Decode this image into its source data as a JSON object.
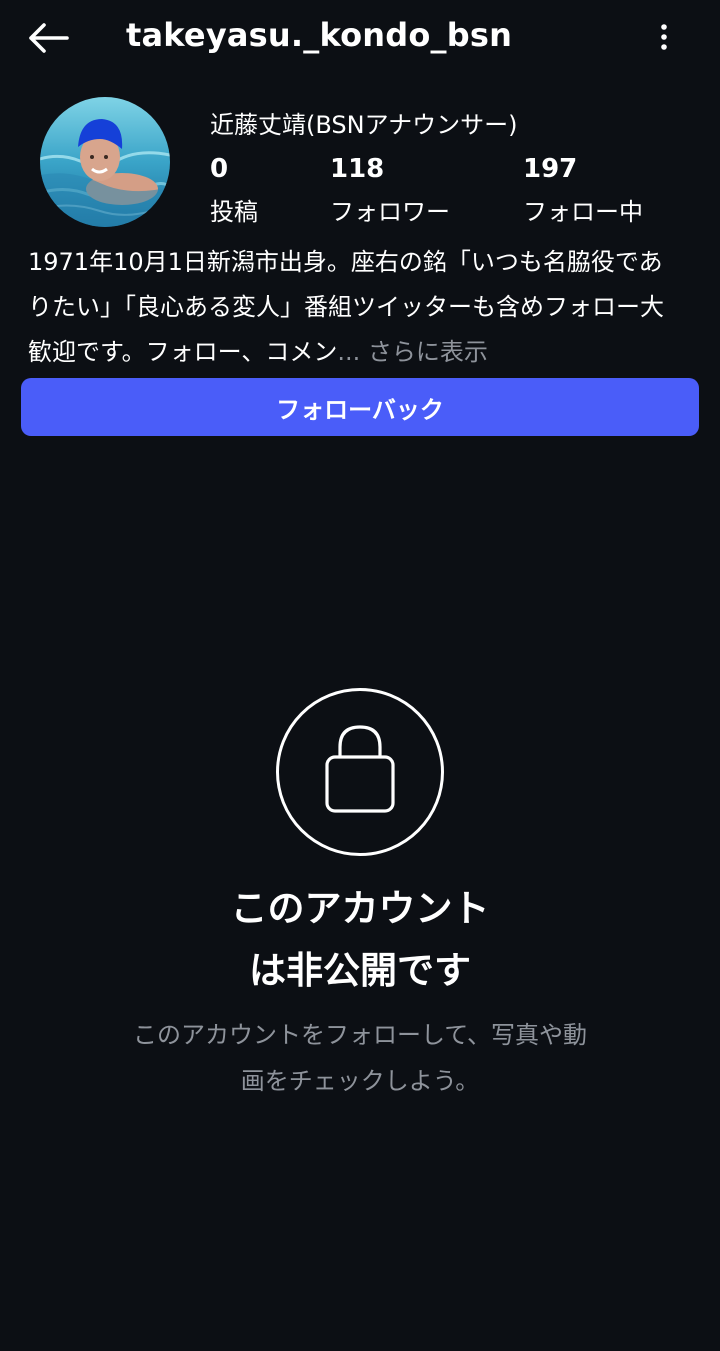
{
  "header": {
    "username": "takeyasu._kondo_bsn",
    "back_icon": "arrow-left-icon",
    "more_icon": "vertical-dots-icon"
  },
  "profile": {
    "avatar_icon": "profile-photo",
    "display_name": "近藤丈靖(BSNアナウンサー)",
    "stats": {
      "posts": {
        "value": "0",
        "label": "投稿"
      },
      "followers": {
        "value": "118",
        "label": "フォロワー"
      },
      "following": {
        "value": "197",
        "label": "フォロー中"
      }
    },
    "bio_lines": [
      "1971年10月1日新潟市出身。座右の銘「いつも名脇役であ",
      "りたい」「良心ある変人」番組ツイッターも含めフォロー大",
      "歓迎です。フォロー、コメン"
    ],
    "bio_ellipsis": "...",
    "bio_more": "さらに表示",
    "follow_back_label": "フォローバック"
  },
  "private_account": {
    "lock_icon": "lock-icon",
    "title_line1": "このアカウント",
    "title_line2": "は非公開です",
    "subtitle_line1": "このアカウントをフォローして、写真や動",
    "subtitle_line2": "画をチェックしよう。"
  },
  "colors": {
    "background": "#0c0f14",
    "accent": "#4a5df9",
    "secondary_text": "#8e939b"
  }
}
